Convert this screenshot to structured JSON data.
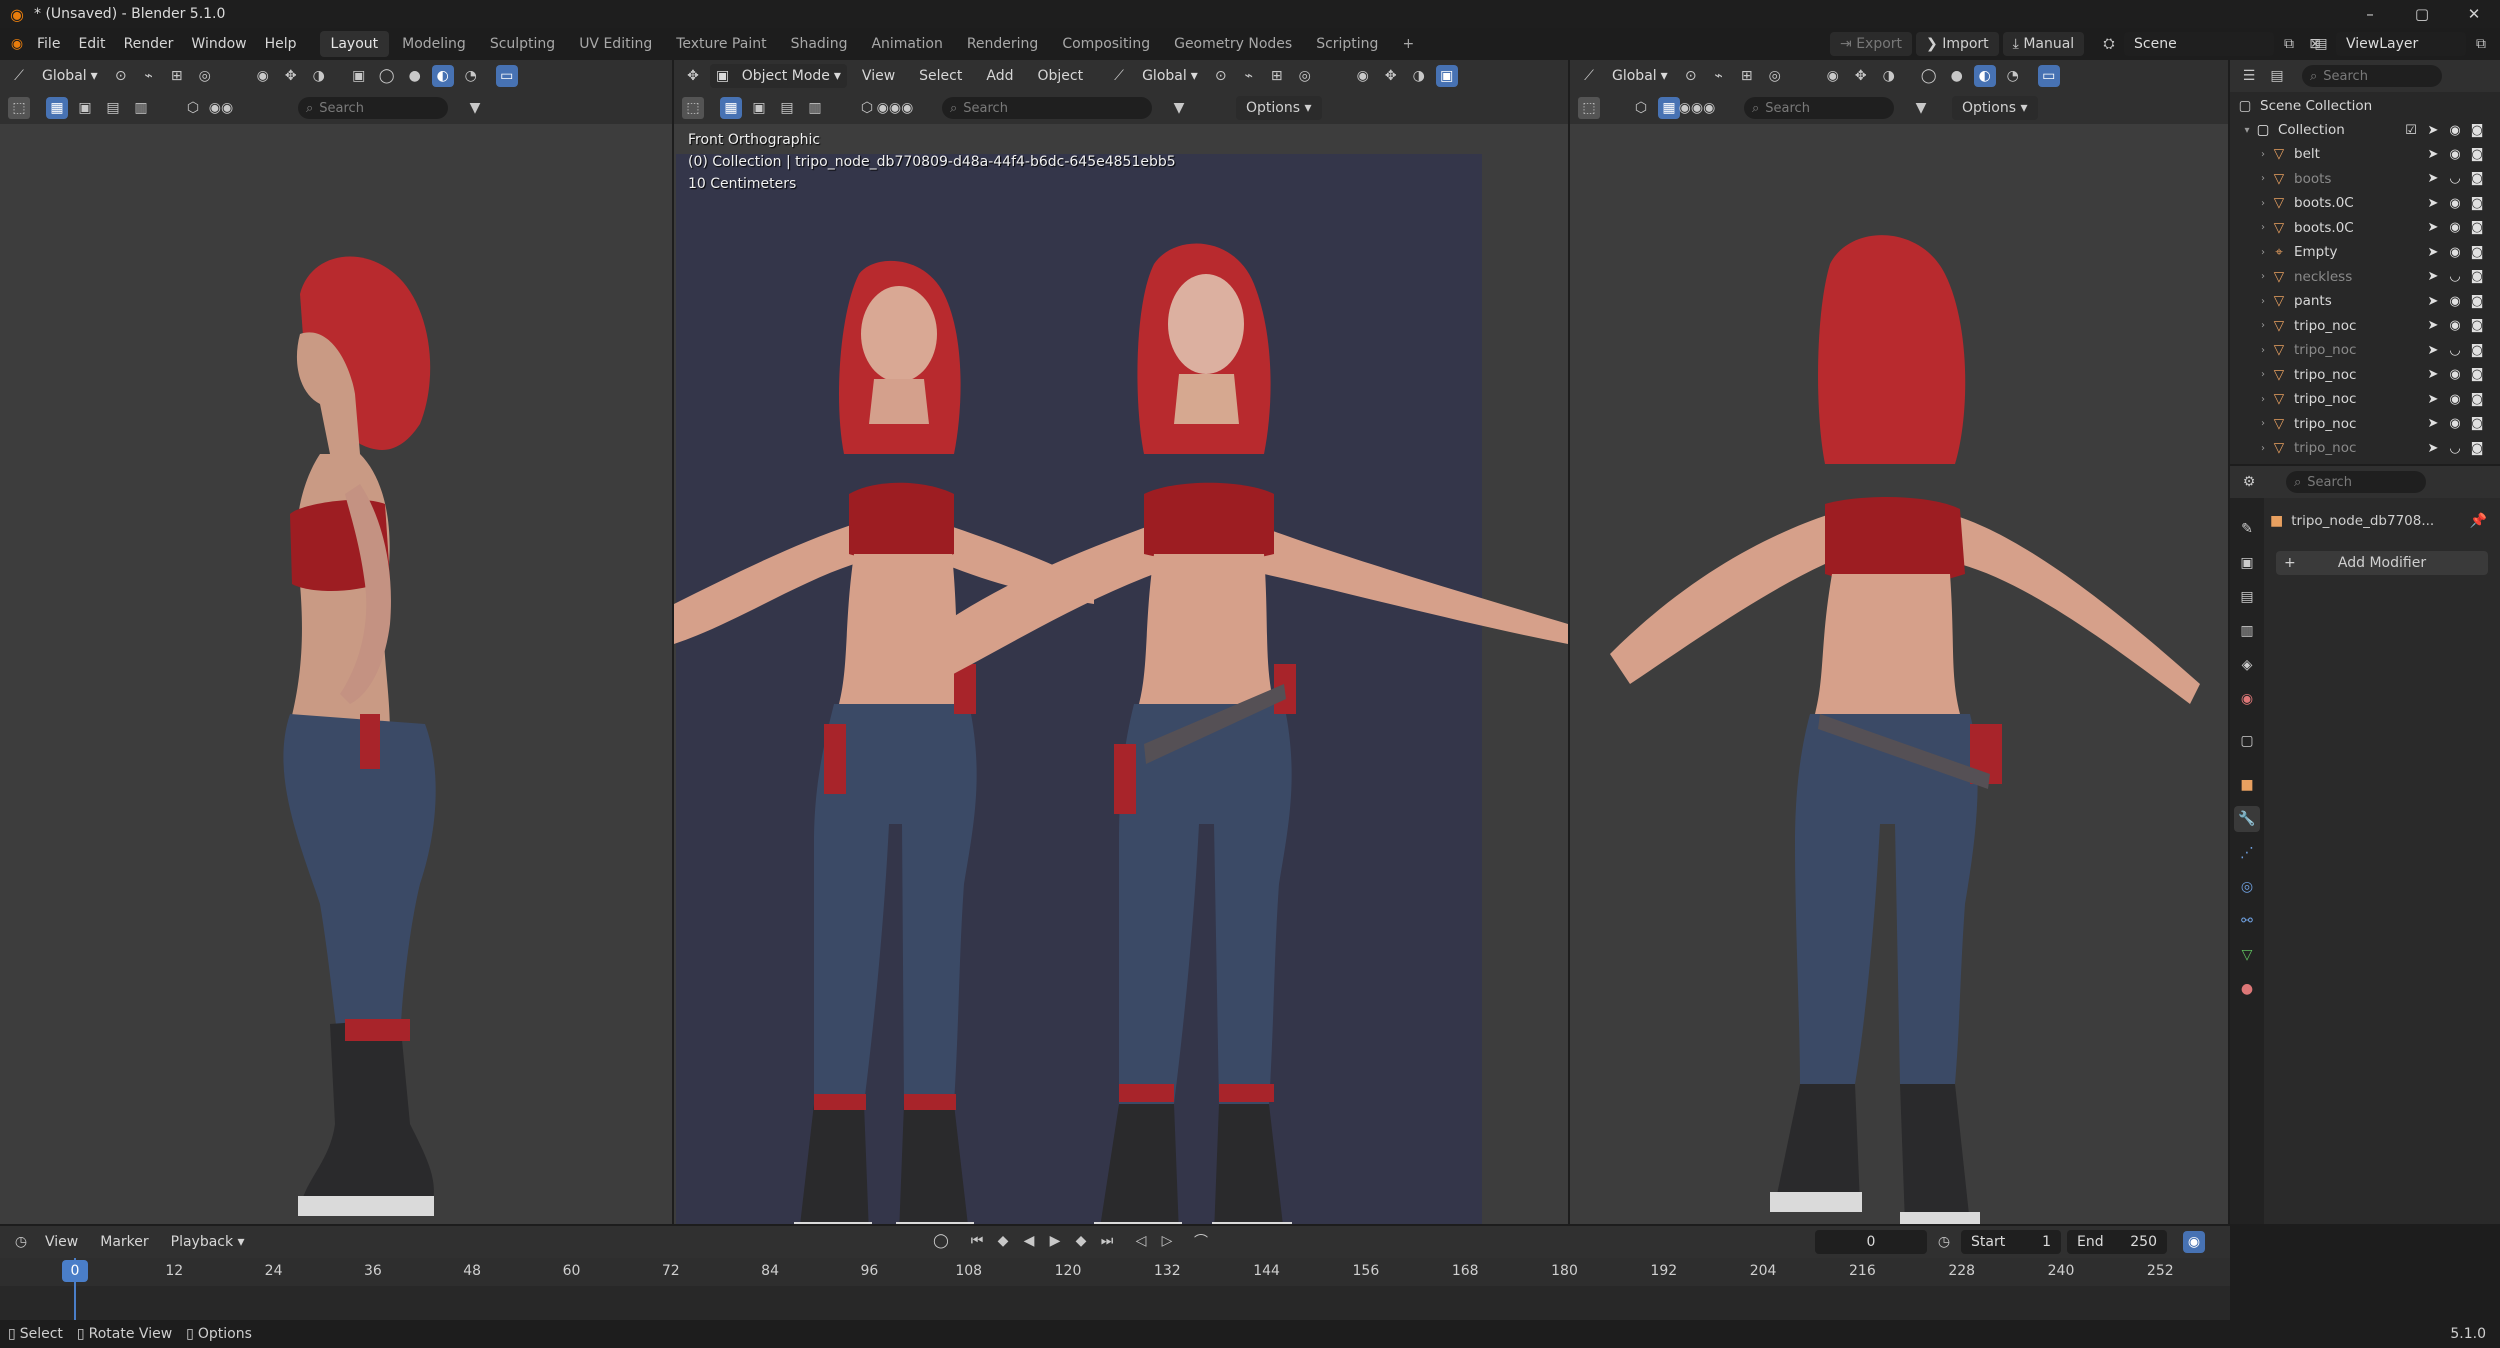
{
  "window": {
    "title": "* (Unsaved) - Blender 5.1.0",
    "controls": [
      "–",
      "▢",
      "✕"
    ]
  },
  "menu": [
    "File",
    "Edit",
    "Render",
    "Window",
    "Help"
  ],
  "workspaces": [
    "Layout",
    "Modeling",
    "Sculpting",
    "UV Editing",
    "Texture Paint",
    "Shading",
    "Animation",
    "Rendering",
    "Compositing",
    "Geometry Nodes",
    "Scripting"
  ],
  "topright": {
    "export": "Export",
    "import": "Import",
    "manual": "Manual",
    "scene": "Scene",
    "viewlayer": "ViewLayer"
  },
  "viewport_left": {
    "orientation": "Global",
    "search_placeholder": "Search"
  },
  "viewport_center": {
    "mode": "Object Mode",
    "menus": [
      "View",
      "Select",
      "Add",
      "Object"
    ],
    "orientation": "Global",
    "search_placeholder": "Search",
    "options": "Options",
    "overlay": [
      "Front Orthographic",
      "(0) Collection | tripo_node_db770809-d48a-44f4-b6dc-645e4851ebb5",
      "10 Centimeters"
    ]
  },
  "viewport_right": {
    "orientation": "Global",
    "search_placeholder": "Search",
    "options": "Options"
  },
  "outliner": {
    "search_placeholder": "Search",
    "scene_collection": "Scene Collection",
    "collection": "Collection",
    "items": [
      {
        "name": "belt",
        "type": "mesh",
        "dim": false
      },
      {
        "name": "boots",
        "type": "mesh",
        "dim": true
      },
      {
        "name": "boots.0C",
        "type": "mesh",
        "dim": false
      },
      {
        "name": "boots.0C",
        "type": "mesh",
        "dim": false
      },
      {
        "name": "Empty",
        "type": "empty",
        "dim": false
      },
      {
        "name": "neckless",
        "type": "mesh",
        "dim": true
      },
      {
        "name": "pants",
        "type": "mesh",
        "dim": false
      },
      {
        "name": "tripo_noc",
        "type": "mesh",
        "dim": false
      },
      {
        "name": "tripo_noc",
        "type": "mesh",
        "dim": true
      },
      {
        "name": "tripo_noc",
        "type": "mesh",
        "dim": false
      },
      {
        "name": "tripo_noc",
        "type": "mesh",
        "dim": false
      },
      {
        "name": "tripo_noc",
        "type": "mesh",
        "dim": false
      },
      {
        "name": "tripo_noc",
        "type": "mesh",
        "dim": true
      }
    ]
  },
  "properties": {
    "search_placeholder": "Search",
    "object_name": "tripo_node_db7708...",
    "add_modifier": "Add Modifier"
  },
  "timeline": {
    "menus": [
      "View",
      "Marker",
      "Playback"
    ],
    "current_frame": "0",
    "start_label": "Start",
    "start": "1",
    "end_label": "End",
    "end": "250",
    "ticks": [
      "0",
      "12",
      "24",
      "36",
      "48",
      "60",
      "72",
      "84",
      "96",
      "108",
      "120",
      "132",
      "144",
      "156",
      "168",
      "180",
      "192",
      "204",
      "216",
      "228",
      "240",
      "252"
    ]
  },
  "status": {
    "select": "Select",
    "rotate": "Rotate View",
    "options": "Options",
    "version": "5.1.0"
  },
  "colors": {
    "accent": "#4772b3",
    "mesh_icon": "#e8a060",
    "hair": "#b82a2e",
    "pants": "#3b4a66"
  }
}
